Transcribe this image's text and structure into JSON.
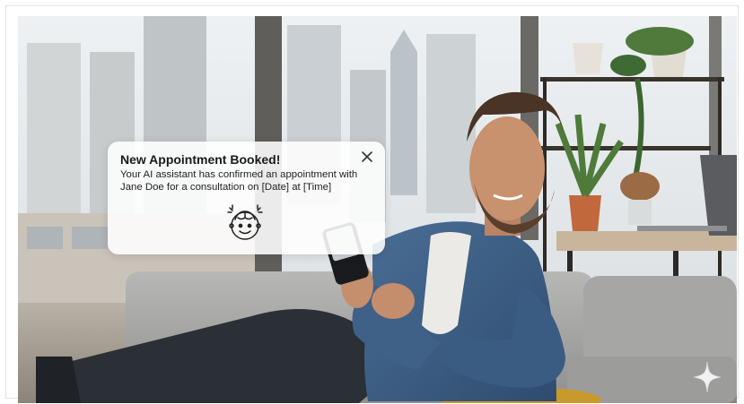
{
  "notification": {
    "title": "New Appointment Booked!",
    "body_line1": "Your AI assistant has confirmed an appointment with",
    "body_line2": "Jane Doe for a consultation on [Date] at [Time]",
    "close_icon": "close-icon",
    "ai_icon": "ai-brain-face-icon"
  },
  "photo": {
    "description_icon": "photo",
    "watermark_icon": "sparkle-icon"
  },
  "colors": {
    "shirt": "#3d5f86",
    "sofa": "#a9aaa8",
    "background_window": "#dfe4e8"
  }
}
